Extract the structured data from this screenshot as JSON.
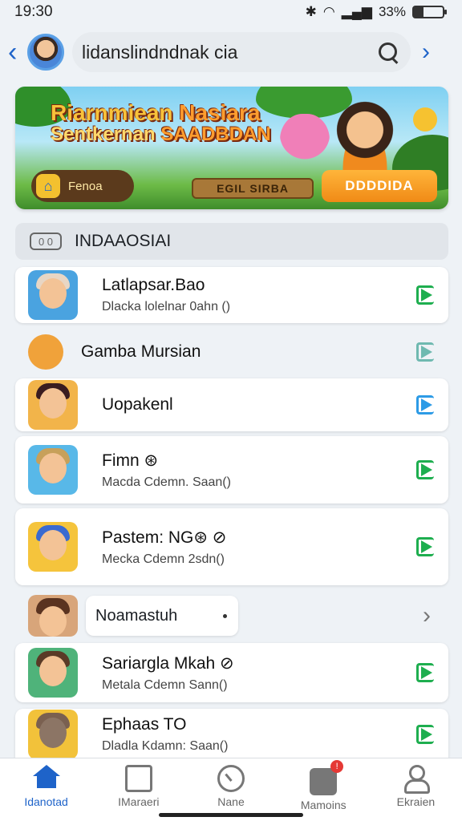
{
  "status_bar": {
    "time": "19:30",
    "battery": "33%",
    "battery_level": 0.33
  },
  "header": {
    "search_text": "lidanslindndnak cia",
    "back_icon": "chevron-left-icon",
    "forward_icon": "chevron-right-icon",
    "search_icon": "search-icon"
  },
  "banner": {
    "title_line1a": "Riarnmiean ",
    "title_line1b": "Nasiara",
    "title_line2a": "Sentkernan ",
    "title_line2b": "SAADBDAN",
    "left_button": "Fenoa",
    "plank_text": "EGIL SIRBA",
    "right_button": "DDDDIDA"
  },
  "section": {
    "icon_text": "0 0",
    "title": "INDAAOSIAI"
  },
  "items": [
    {
      "title": "Latlapsar.Bao",
      "subtitle": "Dlacka lolelnar 0ahn ()",
      "play_color": "#1eae4f"
    },
    {
      "title": "Gamba Mursian",
      "subtitle": "",
      "play_color": "#6fb9b0"
    },
    {
      "title": "Uopakenl",
      "subtitle": "",
      "play_color": "#2d9be6"
    },
    {
      "title": "Fimn ⊛",
      "subtitle": "Macda Cdemn. Saan()",
      "play_color": "#1eae4f"
    },
    {
      "title": "Pastem: NG⊛ ⊘",
      "subtitle": "Mecka Cdemn 2sdn()",
      "play_color": "#1eae4f"
    },
    {
      "title": "Noamastuh",
      "subtitle": "",
      "play_color": ""
    },
    {
      "title": "Sariargla Mkah ⊘",
      "subtitle": "Metala Cdemn Sann()",
      "play_color": "#1eae4f"
    },
    {
      "title": "Ephaas TO",
      "subtitle": "Dladla Kdamn: Saan()",
      "play_color": "#1eae4f"
    }
  ],
  "tabs": [
    {
      "label": "Idanotad",
      "icon": "home-icon"
    },
    {
      "label": "IMaraeri",
      "icon": "box-icon"
    },
    {
      "label": "Nane",
      "icon": "clock-icon"
    },
    {
      "label": "Mamoins",
      "icon": "message-icon",
      "badge": "!"
    },
    {
      "label": "Ekraien",
      "icon": "person-icon"
    }
  ],
  "colors": {
    "accent": "#1e63c9",
    "play_green": "#1eae4f",
    "play_blue": "#2d9be6"
  }
}
